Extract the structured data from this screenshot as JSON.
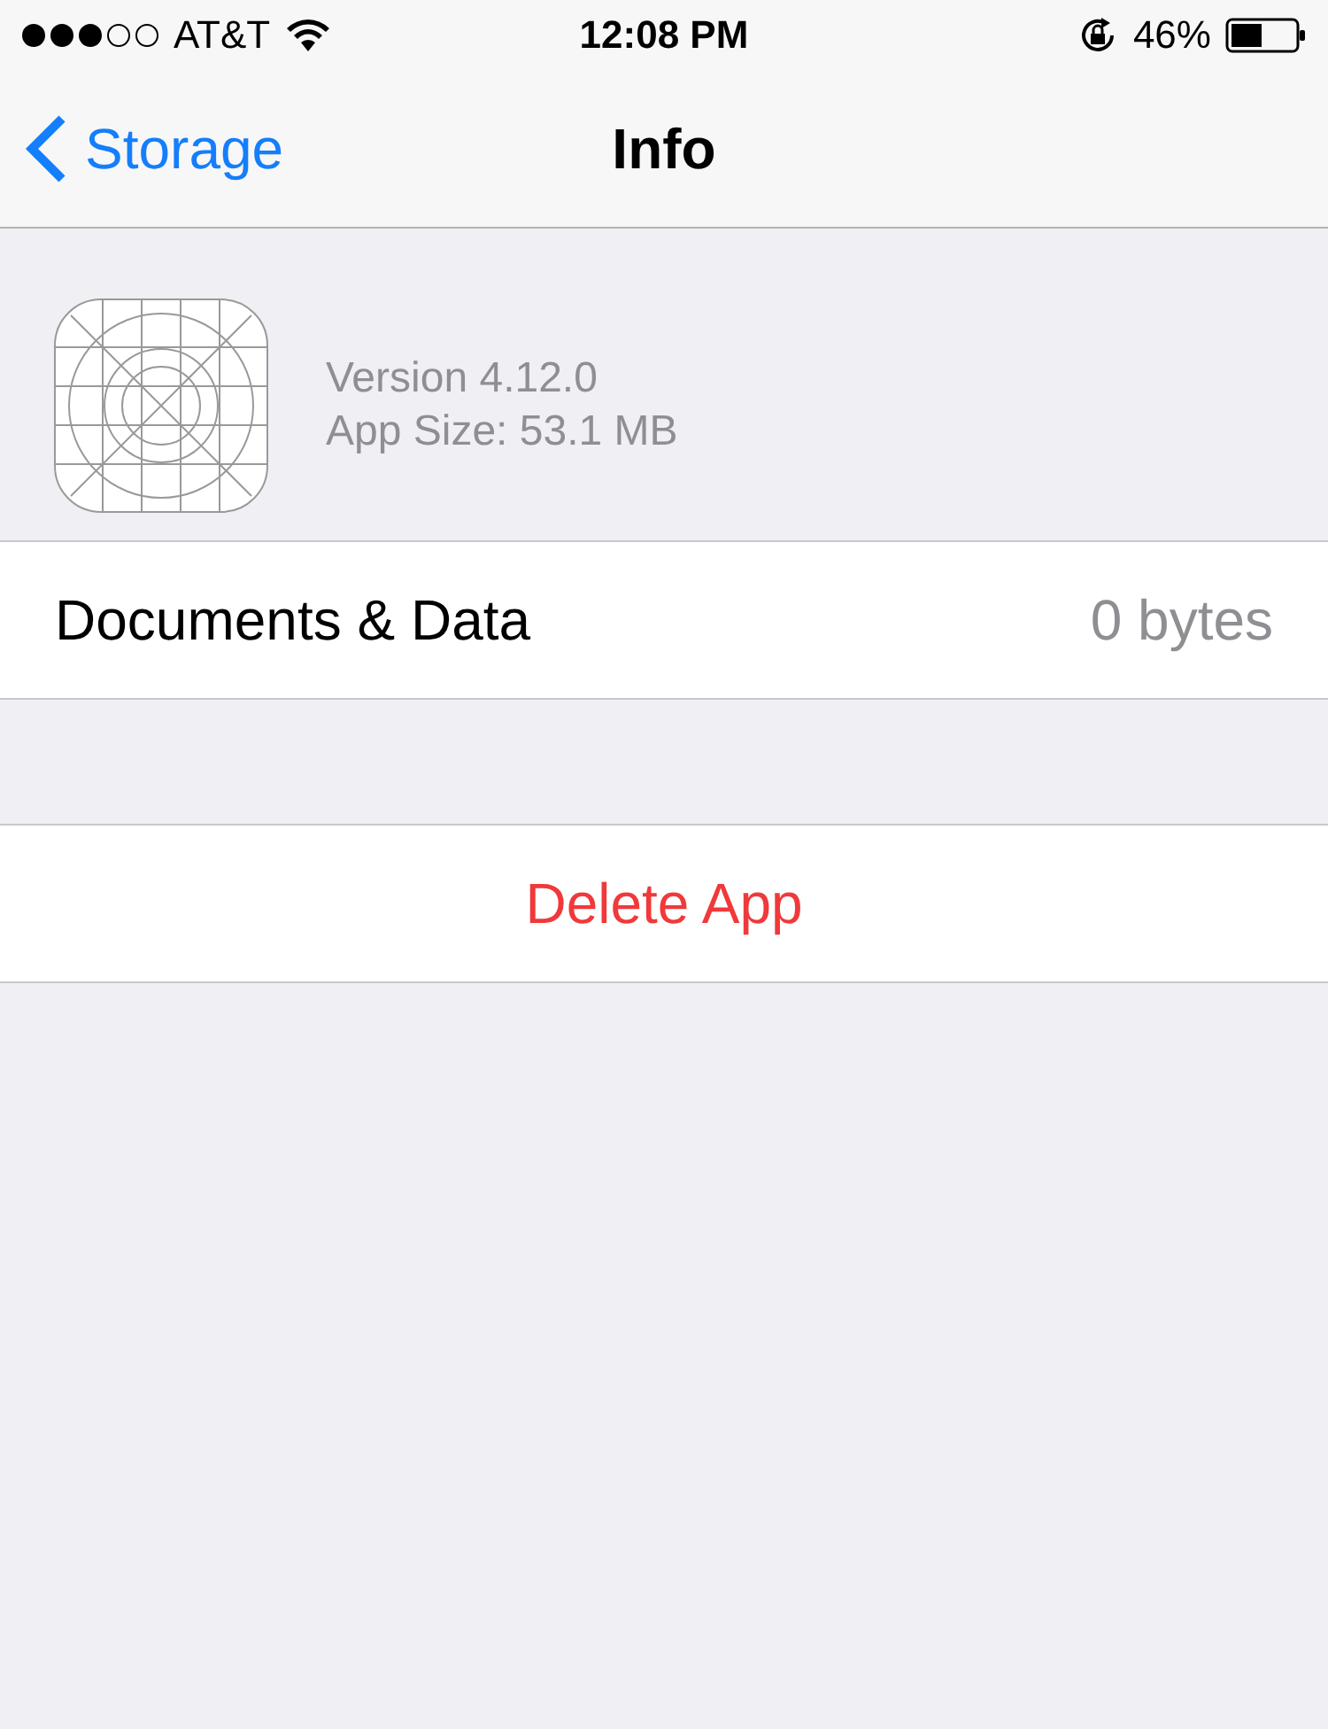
{
  "status_bar": {
    "carrier": "AT&T",
    "time": "12:08 PM",
    "battery": "46%"
  },
  "nav_bar": {
    "back": "Storage",
    "title": "Info"
  },
  "app_info": {
    "version": "Version 4.12.0",
    "size": "App Size: 53.1 MB"
  },
  "documents_row": {
    "label": "Documents & Data",
    "value": "0 bytes"
  },
  "delete_button": "Delete App"
}
